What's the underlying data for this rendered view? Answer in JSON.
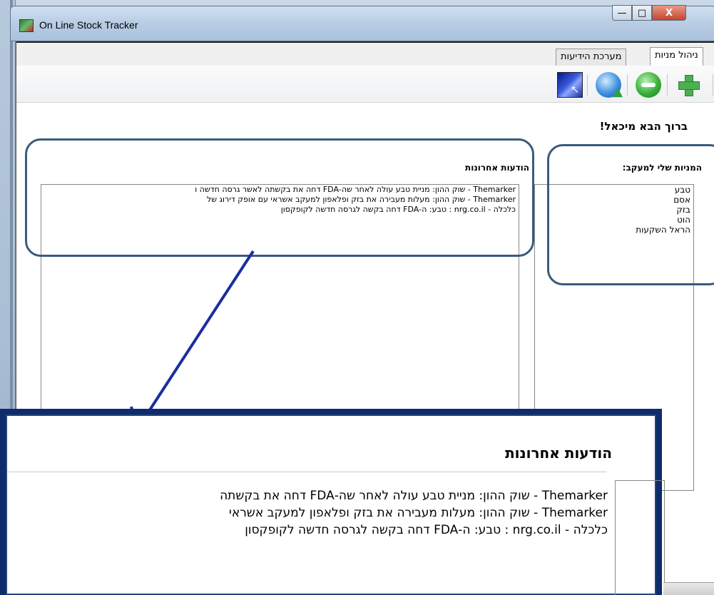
{
  "window": {
    "title": "On Line Stock Tracker",
    "controls": {
      "minimize": "—",
      "maximize": "□",
      "close": "X"
    }
  },
  "tabs": [
    {
      "label": "ניהול מניות",
      "active": true
    },
    {
      "label": "מערכת הידיעות",
      "active": false
    }
  ],
  "toolbar": {
    "buttons": [
      {
        "icon": "add-stock-icon"
      },
      {
        "icon": "remove-stock-icon"
      },
      {
        "icon": "refresh-icon"
      },
      {
        "icon": "screenshot-icon"
      }
    ]
  },
  "welcome": "ברוך הבא מיכאל!",
  "stocks": {
    "heading": "המניות שלי למעקב:",
    "items": [
      "טבע",
      "אסם",
      "בזק",
      "הוט",
      "הראל השקעות"
    ]
  },
  "news": {
    "heading": "הודעות אחרונות",
    "items": [
      "Themarker - שוק ההון: מניית טבע עולה לאחר שה-FDA דחה את בקשתה לאשר גרסה חדשה ו",
      "Themarker - שוק ההון: מעלות מעבירה את בזק ופלאפון למעקב אשראי עם אופק דירוג של",
      "כלכלה - nrg.co.il : טבע: ה-FDA דחה בקשה לגרסה חדשה לקופקסון"
    ]
  },
  "zoom": {
    "heading": "הודעות אחרונות",
    "items": [
      "Themarker - שוק ההון: מניית טבע עולה לאחר שה-FDA דחה את בקשתה",
      "Themarker - שוק ההון: מעלות מעבירה את בזק ופלאפון למעקב אשראי",
      "כלכלה - nrg.co.il : טבע: ה-FDA דחה בקשה לגרסה חדשה לקופקסון"
    ]
  },
  "colors": {
    "callout": "#3b5a7e",
    "arrow": "#1a2ea0",
    "zoom_frame": "#0e2b6b"
  }
}
